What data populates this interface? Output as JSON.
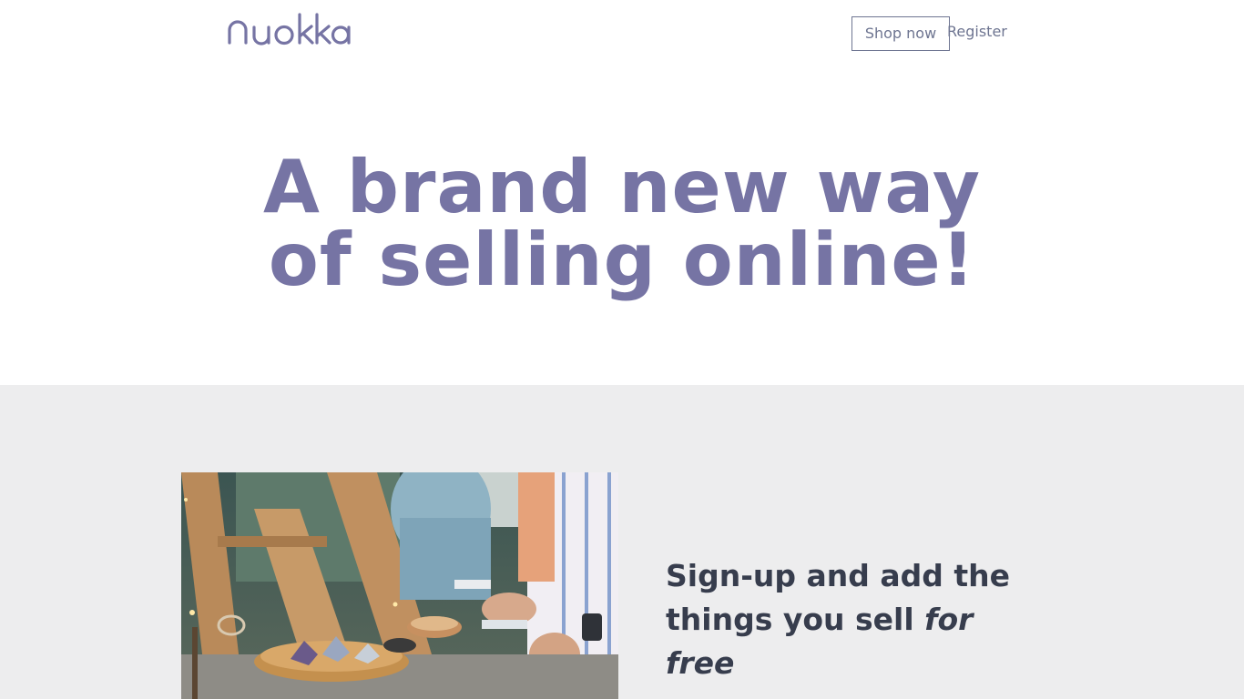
{
  "header": {
    "logo_text": "nuokka",
    "shop_now_label": "Shop now",
    "register_label": "Register"
  },
  "hero": {
    "title_line1": "A brand new way",
    "title_line2": "of selling online!"
  },
  "feature": {
    "text_plain": "Sign-up and add the things you sell ",
    "text_emphasis": "for free"
  },
  "colors": {
    "brand": "#7674a4",
    "text_dark": "#373d4d",
    "section_bg": "#ededee"
  }
}
